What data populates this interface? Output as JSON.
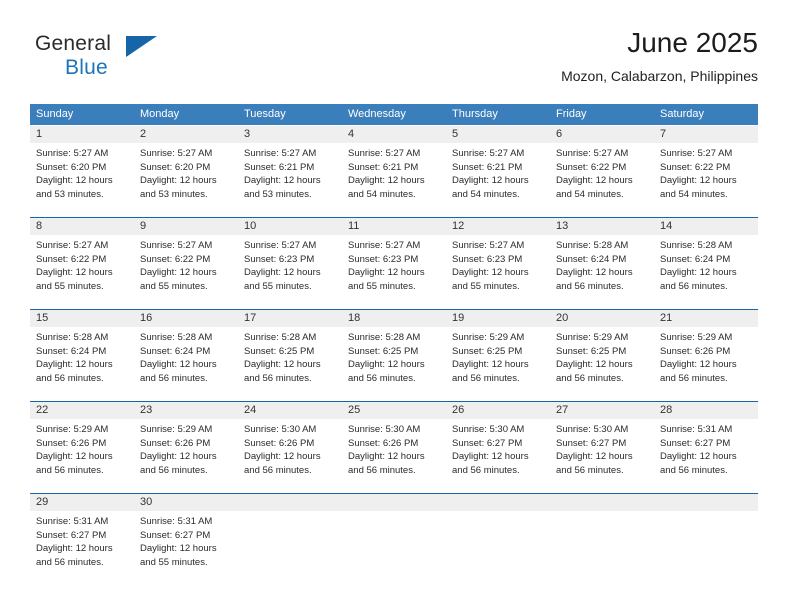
{
  "brand": {
    "name_part1": "General",
    "name_part2": "Blue",
    "flag_icon": "triangle-flag-icon",
    "accent_color": "#1565a8"
  },
  "header": {
    "title": "June 2025",
    "subtitle": "Mozon, Calabarzon, Philippines"
  },
  "theme": {
    "header_row_bg": "#3a7ebc",
    "week_rule": "#1565a8",
    "day_band_bg": "#efefef",
    "text": "#2b2b2b"
  },
  "weekdays": [
    "Sunday",
    "Monday",
    "Tuesday",
    "Wednesday",
    "Thursday",
    "Friday",
    "Saturday"
  ],
  "weeks": [
    [
      {
        "day": "1",
        "sunrise": "Sunrise: 5:27 AM",
        "sunset": "Sunset: 6:20 PM",
        "daylight1": "Daylight: 12 hours",
        "daylight2": "and 53 minutes."
      },
      {
        "day": "2",
        "sunrise": "Sunrise: 5:27 AM",
        "sunset": "Sunset: 6:20 PM",
        "daylight1": "Daylight: 12 hours",
        "daylight2": "and 53 minutes."
      },
      {
        "day": "3",
        "sunrise": "Sunrise: 5:27 AM",
        "sunset": "Sunset: 6:21 PM",
        "daylight1": "Daylight: 12 hours",
        "daylight2": "and 53 minutes."
      },
      {
        "day": "4",
        "sunrise": "Sunrise: 5:27 AM",
        "sunset": "Sunset: 6:21 PM",
        "daylight1": "Daylight: 12 hours",
        "daylight2": "and 54 minutes."
      },
      {
        "day": "5",
        "sunrise": "Sunrise: 5:27 AM",
        "sunset": "Sunset: 6:21 PM",
        "daylight1": "Daylight: 12 hours",
        "daylight2": "and 54 minutes."
      },
      {
        "day": "6",
        "sunrise": "Sunrise: 5:27 AM",
        "sunset": "Sunset: 6:22 PM",
        "daylight1": "Daylight: 12 hours",
        "daylight2": "and 54 minutes."
      },
      {
        "day": "7",
        "sunrise": "Sunrise: 5:27 AM",
        "sunset": "Sunset: 6:22 PM",
        "daylight1": "Daylight: 12 hours",
        "daylight2": "and 54 minutes."
      }
    ],
    [
      {
        "day": "8",
        "sunrise": "Sunrise: 5:27 AM",
        "sunset": "Sunset: 6:22 PM",
        "daylight1": "Daylight: 12 hours",
        "daylight2": "and 55 minutes."
      },
      {
        "day": "9",
        "sunrise": "Sunrise: 5:27 AM",
        "sunset": "Sunset: 6:22 PM",
        "daylight1": "Daylight: 12 hours",
        "daylight2": "and 55 minutes."
      },
      {
        "day": "10",
        "sunrise": "Sunrise: 5:27 AM",
        "sunset": "Sunset: 6:23 PM",
        "daylight1": "Daylight: 12 hours",
        "daylight2": "and 55 minutes."
      },
      {
        "day": "11",
        "sunrise": "Sunrise: 5:27 AM",
        "sunset": "Sunset: 6:23 PM",
        "daylight1": "Daylight: 12 hours",
        "daylight2": "and 55 minutes."
      },
      {
        "day": "12",
        "sunrise": "Sunrise: 5:27 AM",
        "sunset": "Sunset: 6:23 PM",
        "daylight1": "Daylight: 12 hours",
        "daylight2": "and 55 minutes."
      },
      {
        "day": "13",
        "sunrise": "Sunrise: 5:28 AM",
        "sunset": "Sunset: 6:24 PM",
        "daylight1": "Daylight: 12 hours",
        "daylight2": "and 56 minutes."
      },
      {
        "day": "14",
        "sunrise": "Sunrise: 5:28 AM",
        "sunset": "Sunset: 6:24 PM",
        "daylight1": "Daylight: 12 hours",
        "daylight2": "and 56 minutes."
      }
    ],
    [
      {
        "day": "15",
        "sunrise": "Sunrise: 5:28 AM",
        "sunset": "Sunset: 6:24 PM",
        "daylight1": "Daylight: 12 hours",
        "daylight2": "and 56 minutes."
      },
      {
        "day": "16",
        "sunrise": "Sunrise: 5:28 AM",
        "sunset": "Sunset: 6:24 PM",
        "daylight1": "Daylight: 12 hours",
        "daylight2": "and 56 minutes."
      },
      {
        "day": "17",
        "sunrise": "Sunrise: 5:28 AM",
        "sunset": "Sunset: 6:25 PM",
        "daylight1": "Daylight: 12 hours",
        "daylight2": "and 56 minutes."
      },
      {
        "day": "18",
        "sunrise": "Sunrise: 5:28 AM",
        "sunset": "Sunset: 6:25 PM",
        "daylight1": "Daylight: 12 hours",
        "daylight2": "and 56 minutes."
      },
      {
        "day": "19",
        "sunrise": "Sunrise: 5:29 AM",
        "sunset": "Sunset: 6:25 PM",
        "daylight1": "Daylight: 12 hours",
        "daylight2": "and 56 minutes."
      },
      {
        "day": "20",
        "sunrise": "Sunrise: 5:29 AM",
        "sunset": "Sunset: 6:25 PM",
        "daylight1": "Daylight: 12 hours",
        "daylight2": "and 56 minutes."
      },
      {
        "day": "21",
        "sunrise": "Sunrise: 5:29 AM",
        "sunset": "Sunset: 6:26 PM",
        "daylight1": "Daylight: 12 hours",
        "daylight2": "and 56 minutes."
      }
    ],
    [
      {
        "day": "22",
        "sunrise": "Sunrise: 5:29 AM",
        "sunset": "Sunset: 6:26 PM",
        "daylight1": "Daylight: 12 hours",
        "daylight2": "and 56 minutes."
      },
      {
        "day": "23",
        "sunrise": "Sunrise: 5:29 AM",
        "sunset": "Sunset: 6:26 PM",
        "daylight1": "Daylight: 12 hours",
        "daylight2": "and 56 minutes."
      },
      {
        "day": "24",
        "sunrise": "Sunrise: 5:30 AM",
        "sunset": "Sunset: 6:26 PM",
        "daylight1": "Daylight: 12 hours",
        "daylight2": "and 56 minutes."
      },
      {
        "day": "25",
        "sunrise": "Sunrise: 5:30 AM",
        "sunset": "Sunset: 6:26 PM",
        "daylight1": "Daylight: 12 hours",
        "daylight2": "and 56 minutes."
      },
      {
        "day": "26",
        "sunrise": "Sunrise: 5:30 AM",
        "sunset": "Sunset: 6:27 PM",
        "daylight1": "Daylight: 12 hours",
        "daylight2": "and 56 minutes."
      },
      {
        "day": "27",
        "sunrise": "Sunrise: 5:30 AM",
        "sunset": "Sunset: 6:27 PM",
        "daylight1": "Daylight: 12 hours",
        "daylight2": "and 56 minutes."
      },
      {
        "day": "28",
        "sunrise": "Sunrise: 5:31 AM",
        "sunset": "Sunset: 6:27 PM",
        "daylight1": "Daylight: 12 hours",
        "daylight2": "and 56 minutes."
      }
    ],
    [
      {
        "day": "29",
        "sunrise": "Sunrise: 5:31 AM",
        "sunset": "Sunset: 6:27 PM",
        "daylight1": "Daylight: 12 hours",
        "daylight2": "and 56 minutes."
      },
      {
        "day": "30",
        "sunrise": "Sunrise: 5:31 AM",
        "sunset": "Sunset: 6:27 PM",
        "daylight1": "Daylight: 12 hours",
        "daylight2": "and 55 minutes."
      },
      {
        "day": "",
        "sunrise": "",
        "sunset": "",
        "daylight1": "",
        "daylight2": ""
      },
      {
        "day": "",
        "sunrise": "",
        "sunset": "",
        "daylight1": "",
        "daylight2": ""
      },
      {
        "day": "",
        "sunrise": "",
        "sunset": "",
        "daylight1": "",
        "daylight2": ""
      },
      {
        "day": "",
        "sunrise": "",
        "sunset": "",
        "daylight1": "",
        "daylight2": ""
      },
      {
        "day": "",
        "sunrise": "",
        "sunset": "",
        "daylight1": "",
        "daylight2": ""
      }
    ]
  ]
}
